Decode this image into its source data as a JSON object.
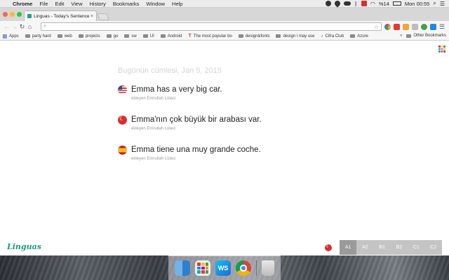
{
  "menubar": {
    "app_name": "Chrome",
    "items": [
      "File",
      "Edit",
      "View",
      "History",
      "Bookmarks",
      "Window",
      "Help"
    ],
    "battery": "%14",
    "clock": "Mon 00:55"
  },
  "browser": {
    "tab_title": "Linguas - Today's Sentence",
    "url": "",
    "bookmarks": [
      "Apps",
      "party hard",
      "web",
      "projects",
      "go",
      "sw",
      "UI",
      "Android",
      "The most popular bo",
      "design&fonts",
      "design i may use",
      "Cifra Club",
      "Azure"
    ],
    "other_bookmarks": "Other Bookmarks"
  },
  "page": {
    "date_heading": "Bugünün cümlesi, Jan 5, 2015",
    "sentences": [
      {
        "lang": "us",
        "text": "Emma has a very big car.",
        "author": "ekleyen Emrullah Lüleci"
      },
      {
        "lang": "tr",
        "text": "Emma'nın çok büyük bir arabası var.",
        "author": "ekleyen Emrullah Lüleci"
      },
      {
        "lang": "es",
        "text": "Emma tiene una muy grande coche.",
        "author": "ekleyen Emrullah Lüleci"
      }
    ]
  },
  "footer": {
    "logo": "Linguas",
    "levels": [
      "A1",
      "A2",
      "B1",
      "B2",
      "C1",
      "C2"
    ],
    "active_level": "A1"
  },
  "colors": {
    "brand": "#1c9a7e",
    "level_active": "#9a9a9a",
    "level_inactive": "#c4c4c4",
    "date_text": "#d4d4d4"
  },
  "dock": {
    "apps": [
      "finder",
      "launchpad",
      "webstorm",
      "chrome",
      "trash"
    ],
    "webstorm_label": "WS"
  }
}
